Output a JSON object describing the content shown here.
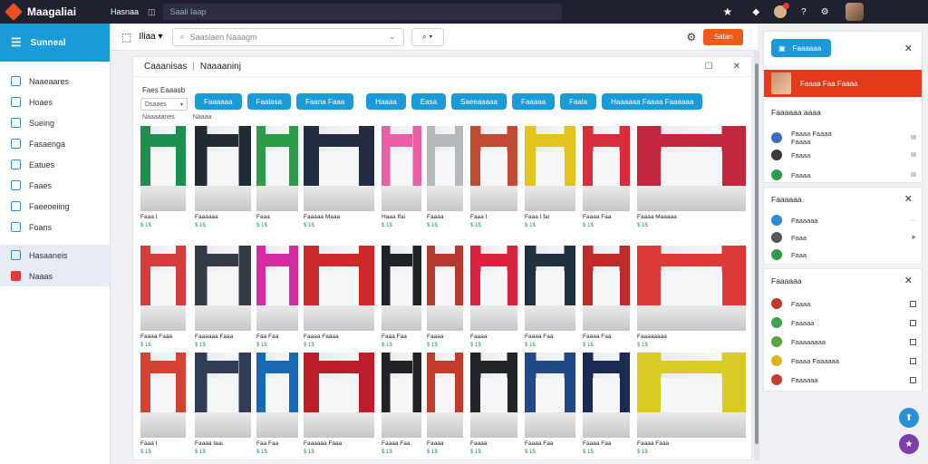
{
  "topbar": {
    "app_name": "Maagaliai",
    "nav": "Hasnaa",
    "hamburger": "◫",
    "search": "Saali Iaap"
  },
  "sidebar": {
    "header": "Sunneal",
    "items": [
      {
        "label": "Naaeaares",
        "icon": "check-icon"
      },
      {
        "label": "Hoaes",
        "icon": "list-icon"
      },
      {
        "label": "Sueing",
        "icon": "clock-icon"
      },
      {
        "label": "Fasaenga",
        "icon": "clock-icon"
      },
      {
        "label": "Eatues",
        "icon": "doc-icon"
      },
      {
        "label": "Faaes",
        "icon": "doc-icon"
      },
      {
        "label": "Faeeoeiing",
        "icon": "monitor-icon"
      },
      {
        "label": "Foans",
        "icon": "doc-icon"
      },
      {
        "label": "Hasaaneis",
        "icon": "square-icon"
      },
      {
        "label": "Naaas",
        "icon": "alert-icon"
      }
    ]
  },
  "toolbar": {
    "dropdown": "Iliaa",
    "search_placeholder": "Saaslaen Naaagm",
    "orange_button": "Satan"
  },
  "panel": {
    "title": "Caaanisas",
    "subtitle": "Naaaaninj",
    "filter_label": "Faes Eaaasb",
    "filter_value": "Dsaaes",
    "chips": [
      "Faaaaaa",
      "Faalasa",
      "Faana Faaa",
      "Haaaa",
      "Easa",
      "Saeeaaaaa",
      "Faaaaa",
      "Faala",
      "Haaaaaa Faaaa Faaaaaa"
    ],
    "sublabels": [
      "Naaaaanes",
      "Naaaa"
    ]
  },
  "cards": [
    {
      "t1": "Faaa I",
      "t2": "$ 1$",
      "color": "#1d8f4e"
    },
    {
      "t1": "Faaaaaa",
      "t2": "$ 1$",
      "color": "#222a35"
    },
    {
      "t1": "Faaa",
      "t2": "$ 1$",
      "color": "#2b9b47"
    },
    {
      "t1": "Faaaaa Maaa",
      "t2": "$ 1$",
      "color": "#232c3f"
    },
    {
      "t1": "Haaa Ifai",
      "t2": "$ 1$",
      "color": "#e85fa3"
    },
    {
      "t1": "Faaaa",
      "t2": "$ 1$",
      "color": "#b5b8bd"
    },
    {
      "t1": "Faaa I",
      "t2": "$ 1$",
      "color": "#c14a35"
    },
    {
      "t1": "Faaa I fai",
      "t2": "$ 1$",
      "color": "#e2c41e"
    },
    {
      "t1": "Faaaa Faa",
      "t2": "$ 1$",
      "color": "#d82d3b"
    },
    {
      "t1": "Faaaa Maaaaa",
      "t2": "$ 1$",
      "color": "#c0263d"
    },
    {
      "t1": "Faaaa Faaa",
      "t2": "$ 1$",
      "color": "#d73c3c"
    },
    {
      "t1": "Faaaaaa Faaa",
      "t2": "$ 1$",
      "color": "#343b47"
    },
    {
      "t1": "Faa Faa",
      "t2": "$ 1$",
      "color": "#d22ea1"
    },
    {
      "t1": "Faaaa Faaaa",
      "t2": "$ 1$",
      "color": "#cc2a2a"
    },
    {
      "t1": "Faaa Faa",
      "t2": "$ 1$",
      "color": "#1f2227"
    },
    {
      "t1": "Faaaa",
      "t2": "$ 1$",
      "color": "#b7392f"
    },
    {
      "t1": "Faaaa",
      "t2": "$ 1$",
      "color": "#d8203f"
    },
    {
      "t1": "Faaaa Faa",
      "t2": "$ 1$",
      "color": "#233040"
    },
    {
      "t1": "Faaaa Faa",
      "t2": "$ 1$",
      "color": "#bf2b2b"
    },
    {
      "t1": "Faaaaaaaa",
      "t2": "$ 1$",
      "color": "#d93a36"
    },
    {
      "t1": "Faaa I",
      "t2": "$ 1$",
      "color": "#d24332"
    },
    {
      "t1": "Faaaa Iaai",
      "t2": "$ 1$",
      "color": "#2f3e55"
    },
    {
      "t1": "Faa Faa",
      "t2": "$ 1$",
      "color": "#1868b5"
    },
    {
      "t1": "Faaaaaa Faaa",
      "t2": "$ 1$",
      "color": "#bd1d28"
    },
    {
      "t1": "Faaaa Faa",
      "t2": "$ 1$",
      "color": "#202228"
    },
    {
      "t1": "Faaaa",
      "t2": "$ 1$",
      "color": "#c33b2b"
    },
    {
      "t1": "Faaaa",
      "t2": "$ 1$",
      "color": "#22262b"
    },
    {
      "t1": "Faaaa Faa",
      "t2": "$ 1$",
      "color": "#204a86"
    },
    {
      "t1": "Faaaa Faa",
      "t2": "$ 1$",
      "color": "#1a2a55"
    },
    {
      "t1": "Faaaa Faaa",
      "t2": "$ 1$",
      "color": "#d9cb24"
    }
  ],
  "right": {
    "top_button": "Faaaaaa",
    "notif": "Faaaa Faa Faaaa",
    "sec1_title": "Faaaaaa aaaa",
    "sec1_rows": [
      {
        "label": "Faaaa Faaaa\nFaaaa",
        "right": "III"
      },
      {
        "label": "Faaaa",
        "right": "III"
      },
      {
        "label": "Faaaa",
        "right": "III"
      }
    ],
    "sec2_title": "Faaaaaa",
    "sec2_rows": [
      {
        "label": "Faaaaaa",
        "right": "···"
      },
      {
        "label": "Faaa",
        "right": "➤"
      },
      {
        "label": "Faaa",
        "right": ""
      }
    ],
    "sec3_title": "Faaaaaa",
    "sec3_rows": [
      {
        "label": "Faaaa"
      },
      {
        "label": "Faaaaa"
      },
      {
        "label": "Faaaaaaaa"
      },
      {
        "label": "Faaaa Faaaaaa"
      },
      {
        "label": "Faaaaaa"
      }
    ]
  }
}
